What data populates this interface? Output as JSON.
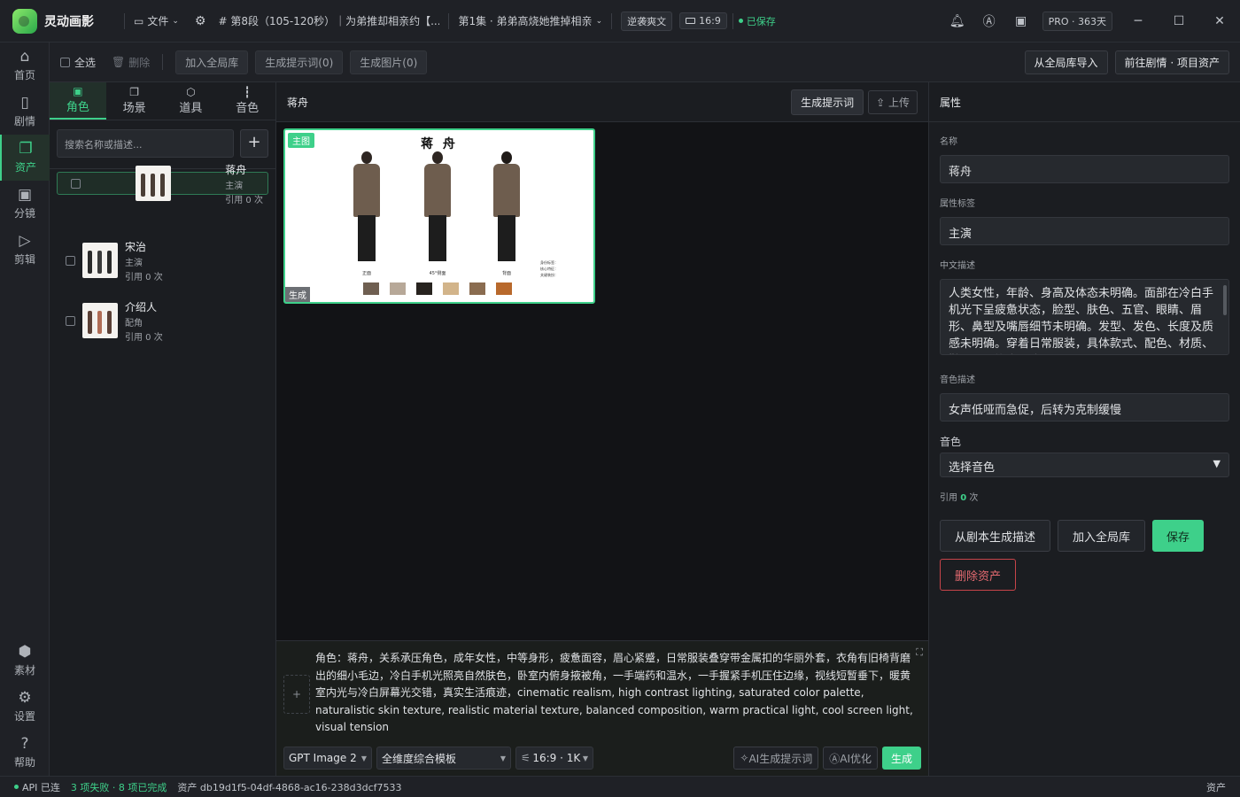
{
  "app": {
    "name": "灵动画影"
  },
  "titlebar": {
    "file_menu": "文件",
    "segment": "# 第8段（105-120秒）｜为弟推却相亲约【...",
    "episode": "第1集 · 弟弟高烧她推掉相亲",
    "tag": "逆袭爽文",
    "ratio": "16:9",
    "saved": "已保存",
    "plan": "PRO · 363天"
  },
  "sidebar": {
    "items": [
      {
        "label": "首页",
        "icon": "home-icon"
      },
      {
        "label": "剧情",
        "icon": "book-icon"
      },
      {
        "label": "资产",
        "icon": "assets-icon",
        "active": true
      },
      {
        "label": "分镜",
        "icon": "storyboard-icon"
      },
      {
        "label": "剪辑",
        "icon": "edit-icon"
      }
    ],
    "bottom": [
      {
        "label": "素材",
        "icon": "cube-icon"
      },
      {
        "label": "设置",
        "icon": "gear-icon"
      },
      {
        "label": "帮助",
        "icon": "help-icon"
      }
    ]
  },
  "toolbar": {
    "select_all": "全选",
    "delete": "删除",
    "add_global": "加入全局库",
    "gen_prompts": "生成提示词(0)",
    "gen_images": "生成图片(0)",
    "import_global": "从全局库导入",
    "goto_project": "前往剧情 · 项目资产"
  },
  "left": {
    "tabs": [
      {
        "label": "角色",
        "active": true
      },
      {
        "label": "场景"
      },
      {
        "label": "道具"
      },
      {
        "label": "音色"
      }
    ],
    "search_placeholder": "搜索名称或描述...",
    "items": [
      {
        "name": "蒋舟",
        "role": "主演",
        "usage": "引用 0 次",
        "selected": true
      },
      {
        "name": "宋治",
        "role": "主演",
        "usage": "引用 0 次"
      },
      {
        "name": "介绍人",
        "role": "配角",
        "usage": "引用 0 次"
      }
    ]
  },
  "center": {
    "title": "蒋舟",
    "gen_prompt_btn": "生成提示词",
    "upload_btn": "上传",
    "card": {
      "badge_main": "主图",
      "badge_gen": "生成",
      "sheet_title": "蒋 舟",
      "views": [
        "正面",
        "45°侧面",
        "背面"
      ],
      "notes": [
        "身份标签：",
        "核心特征：",
        "关键装扮："
      ],
      "swatches": [
        "#6f5f51",
        "#b7a898",
        "#27231f",
        "#d2b48a",
        "#8a6c50",
        "#b8692c"
      ]
    },
    "prompt": {
      "add": "+",
      "text": "角色：蒋舟，关系承压角色，成年女性，中等身形，疲惫面容，眉心紧蹙，日常服装叠穿带金属扣的华丽外套，衣角有旧椅背磨出的细小毛边，冷白手机光照亮自然肤色，卧室内俯身掖被角，一手端药和温水，一手握紧手机压住边缘，视线短暂垂下，暖黄室内光与冷白屏幕光交错，真实生活痕迹，cinematic realism, high contrast lighting, saturated color palette, naturalistic skin texture, realistic material texture, balanced composition, warm practical light, cool screen light, visual tension",
      "model": "GPT Image 2",
      "template": "全维度综合模板",
      "size": "16:9 · 1K",
      "ai_prompt": "AI生成提示词",
      "ai_optimize": "AI优化",
      "generate": "生成"
    }
  },
  "right": {
    "header": "属性",
    "name_label": "名称",
    "name_value": "蒋舟",
    "tag_label": "属性标签",
    "tag_value": "主演",
    "desc_label": "中文描述",
    "desc_value": "人类女性，年龄、身高及体态未明确。面部在冷白手机光下呈疲惫状态，脸型、肤色、五官、眼睛、眉形、鼻型及嘴唇细节未明确。发型、发色、长度及质感未明确。穿着日常服装，具体款式、配色、材质、鞋履及配饰未明确",
    "voice_desc_label": "音色描述",
    "voice_desc_value": "女声低哑而急促，后转为克制缓慢",
    "voice_label": "音色",
    "voice_select": "选择音色",
    "usage_prefix": "引用",
    "usage_count": "0",
    "usage_suffix": "次",
    "btn_from_script": "从剧本生成描述",
    "btn_add_global": "加入全局库",
    "btn_save": "保存",
    "btn_delete": "删除资产"
  },
  "status": {
    "api": "API 已连",
    "jobs": "3 项失败 · 8 项已完成",
    "asset": "资产 db19d1f5-04df-4868-ac16-238d3dcf7533",
    "right": "资产"
  },
  "colors": {
    "accent": "#3ed08a",
    "danger": "#e36a70",
    "bg": "#1b1d21"
  }
}
